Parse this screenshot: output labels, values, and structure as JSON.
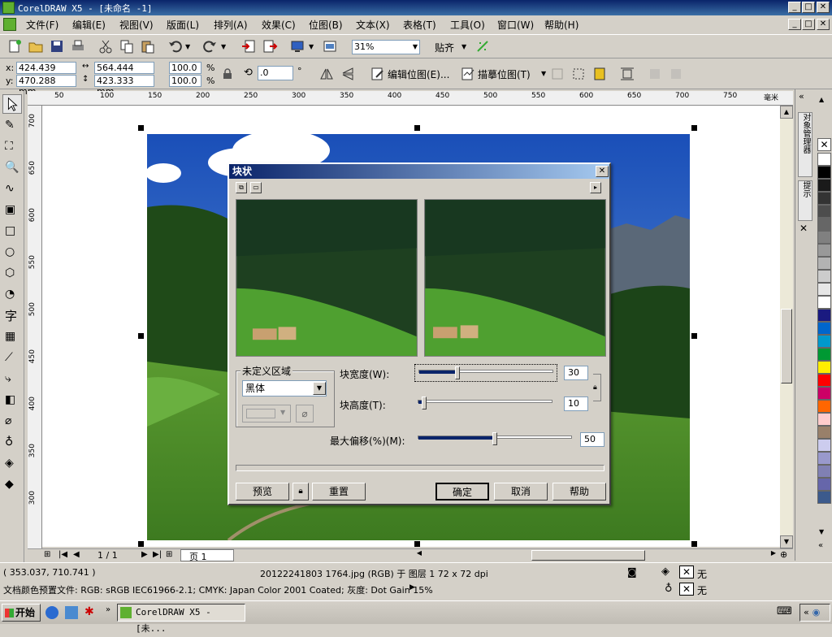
{
  "window": {
    "title": "CorelDRAW X5 - [未命名 -1]"
  },
  "menu": [
    "文件(F)",
    "编辑(E)",
    "视图(V)",
    "版面(L)",
    "排列(A)",
    "效果(C)",
    "位图(B)",
    "文本(X)",
    "表格(T)",
    "工具(O)",
    "窗口(W)",
    "帮助(H)"
  ],
  "toolbar": {
    "zoom": "31%",
    "snap_label": "贴齐"
  },
  "propbar": {
    "x": "424.439 mm",
    "y": "470.288 mm",
    "w": "564.444 mm",
    "h": "423.333 mm",
    "sx": "100.0",
    "sy": "100.0",
    "pct": "%",
    "angle": ".0",
    "deg": "°",
    "edit_bitmap": "编辑位图(E)...",
    "trace_bitmap": "描摹位图(T)"
  },
  "ruler": {
    "h": [
      "50",
      "100",
      "150",
      "200",
      "250",
      "300",
      "350",
      "400",
      "450",
      "500",
      "550",
      "600",
      "650",
      "700",
      "750"
    ],
    "h_unit": "毫米",
    "v": [
      "700",
      "650",
      "600",
      "550",
      "500",
      "450",
      "400",
      "350",
      "300"
    ]
  },
  "dialog": {
    "title": "块状",
    "undefined_area_label": "未定义区域",
    "fill_option": "黑体",
    "block_width_label": "块宽度(W):",
    "block_width": "30",
    "block_height_label": "块高度(T):",
    "block_height": "10",
    "max_offset_label": "最大偏移(%)(M):",
    "max_offset": "50",
    "preview": "预览",
    "reset": "重置",
    "ok": "确定",
    "cancel": "取消",
    "help": "帮助"
  },
  "page_nav": {
    "counter": "1 / 1",
    "tab": "页 1"
  },
  "docker_tabs": [
    "对象管理器",
    "提示"
  ],
  "status": {
    "coords": "( 353.037, 710.741 )",
    "info": "20122241803 1764.jpg (RGB) 于 图层 1 72 x 72 dpi",
    "profile": "文档颜色预置文件: RGB: sRGB IEC61966-2.1; CMYK: Japan Color 2001 Coated; 灰度: Dot Gain 15%",
    "fill_none": "无",
    "outline_none": "无"
  },
  "taskbar": {
    "start": "开始",
    "task": "CorelDRAW X5 - [未..."
  },
  "palette_colors": [
    "#ffffff",
    "#000000",
    "#1a1a1a",
    "#333333",
    "#4d4d4d",
    "#666666",
    "#808080",
    "#999999",
    "#b3b3b3",
    "#cccccc",
    "#e6e6e6",
    "#ffffff",
    "#1a1a80",
    "#0066cc",
    "#0099cc",
    "#009933",
    "#ffee00",
    "#ff0000",
    "#cc0066",
    "#ff6600",
    "#ffcccc",
    "#99806a",
    "#ccccee",
    "#9999cc",
    "#8080b3",
    "#6666aa",
    "#3c5a8c"
  ]
}
